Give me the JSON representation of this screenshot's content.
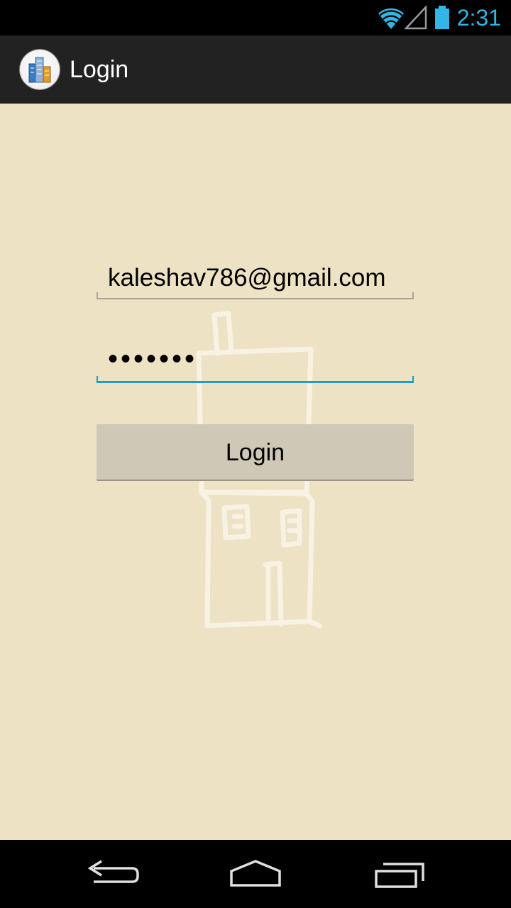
{
  "status_bar": {
    "time": "2:31",
    "icons": [
      "wifi-icon",
      "signal-icon",
      "battery-icon"
    ],
    "accent_color": "#33B5E5"
  },
  "action_bar": {
    "title": "Login",
    "icon": "app-logo-icon",
    "background": "#222222"
  },
  "form": {
    "email_value": "kaleshav786@gmail.com",
    "password_value": "•••••••",
    "login_button_label": "Login",
    "background": "#EEE2C5",
    "focus_color": "#1E9CD0"
  },
  "nav_bar": {
    "buttons": [
      "back-icon",
      "home-icon",
      "recent-apps-icon"
    ]
  }
}
